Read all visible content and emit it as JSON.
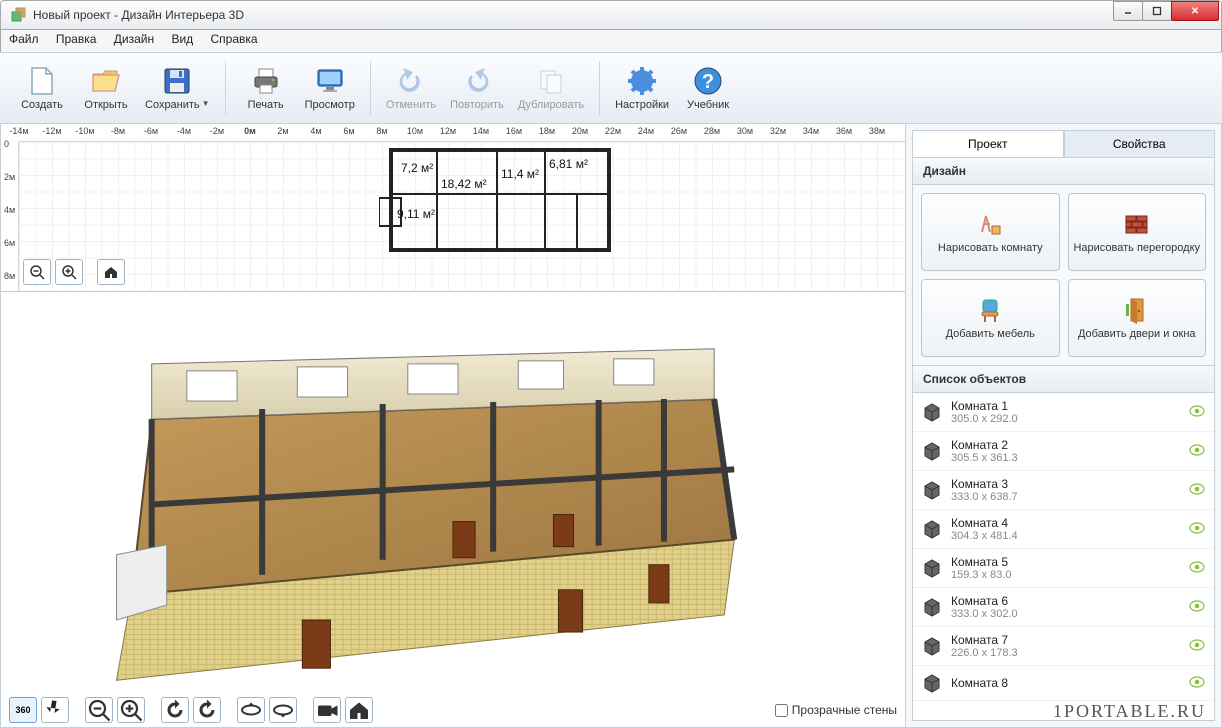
{
  "window": {
    "title": "Новый проект - Дизайн Интерьера 3D"
  },
  "menu": {
    "file": "Файл",
    "edit": "Правка",
    "design": "Дизайн",
    "view": "Вид",
    "help": "Справка"
  },
  "toolbar": {
    "create": "Создать",
    "open": "Открыть",
    "save": "Сохранить",
    "print": "Печать",
    "preview": "Просмотр",
    "undo": "Отменить",
    "redo": "Повторить",
    "duplicate": "Дублировать",
    "settings": "Настройки",
    "tutorial": "Учебник"
  },
  "ruler": {
    "zero": "0м",
    "neg": [
      "-2м",
      "-4м",
      "-6м",
      "-8м",
      "-10м",
      "-12м",
      "-14м"
    ],
    "pos": [
      "2м",
      "4м",
      "6м",
      "8м",
      "10м",
      "12м",
      "14м",
      "16м",
      "18м",
      "20м",
      "22м",
      "24м",
      "26м",
      "28м",
      "30м",
      "32м",
      "34м",
      "36м",
      "38м"
    ],
    "vert": [
      "0",
      "2м",
      "4м",
      "6м",
      "8м"
    ]
  },
  "plan_labels": {
    "r1": "7,2 м²",
    "r2": "18,42 м²",
    "r3": "11,4 м²",
    "r4": "6,81 м²",
    "r5": "9,11 м²"
  },
  "tabs": {
    "project": "Проект",
    "props": "Свойства"
  },
  "design_section": "Дизайн",
  "design_buttons": {
    "draw_room": "Нарисовать комнату",
    "draw_partition": "Нарисовать перегородку",
    "add_furniture": "Добавить мебель",
    "add_doors": "Добавить двери и окна"
  },
  "objects_header": "Список объектов",
  "objects": [
    {
      "name": "Комната 1",
      "dim": "305.0 x 292.0"
    },
    {
      "name": "Комната 2",
      "dim": "305.5 x 361.3"
    },
    {
      "name": "Комната 3",
      "dim": "333.0 x 638.7"
    },
    {
      "name": "Комната 4",
      "dim": "304.3 x 481.4"
    },
    {
      "name": "Комната 5",
      "dim": "159.3 x 83.0"
    },
    {
      "name": "Комната 6",
      "dim": "333.0 x 302.0"
    },
    {
      "name": "Комната 7",
      "dim": "226.0 x 178.3"
    },
    {
      "name": "Комната 8",
      "dim": ""
    }
  ],
  "transparent_walls": "Прозрачные стены",
  "watermark": "1PORTABLE.RU"
}
